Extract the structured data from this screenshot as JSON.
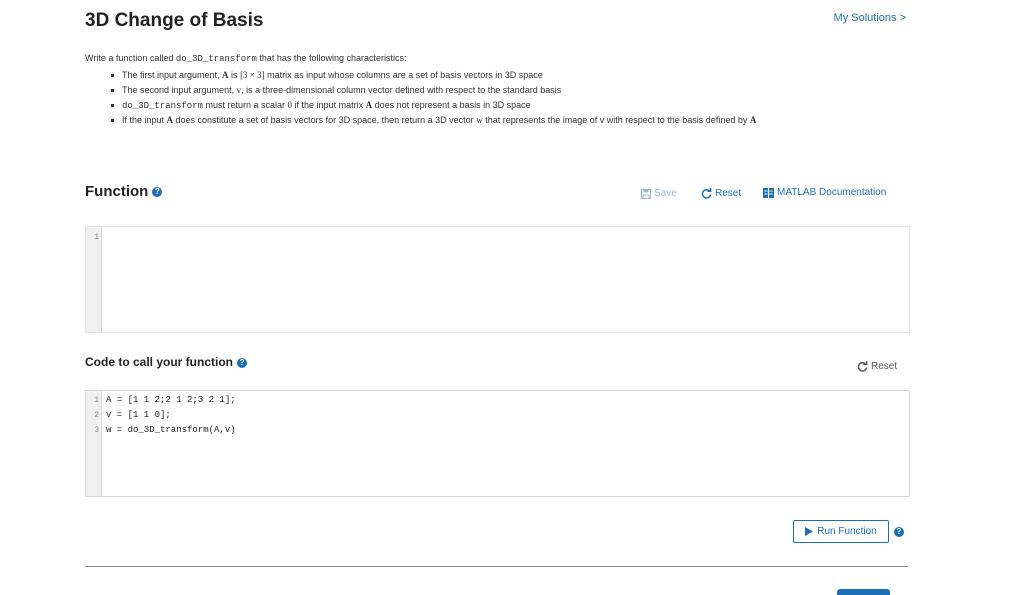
{
  "header": {
    "title": "3D Change of Basis",
    "my_solutions": "My Solutions >"
  },
  "description": {
    "intro_prefix": "Write a function called ",
    "function_name": "do_3D_transform",
    "intro_suffix": " that has the following characteristics:",
    "items": [
      {
        "p1": "The first input argument, ",
        "m1": "A",
        "p2": " is ",
        "m2": "[3 × 3]",
        "p3": " matrix as input whose columns are a set of basis vectors in 3D space"
      },
      {
        "p1": "The second input argument,  ",
        "m1": "v",
        "p2": ", is a three-dimensional column vector defined with respect to the standard basis"
      },
      {
        "m0": "do_3D_transform",
        "p1": " must return a scalar ",
        "m1": "0",
        "p2": " if the input matrix ",
        "m2": "A",
        "p3": " does not represent a basis in 3D space"
      },
      {
        "p1": "If the input ",
        "m1": "A",
        "p2": " does constitute a set of basis vectors for 3D space, then return a 3D vector ",
        "m2": "w",
        "p3": " that represents the image of v with respect to the basis defined by ",
        "m3": "A"
      }
    ]
  },
  "function_section": {
    "title": "Function",
    "save_label": "Save",
    "reset_label": "Reset",
    "docs_label": "MATLAB Documentation",
    "line_numbers": [
      "1"
    ]
  },
  "call_section": {
    "title": "Code to call your function",
    "reset_label": "Reset",
    "lines": [
      {
        "num": "1",
        "code": "A = [1 1 2;2 1 2;3 2 1];"
      },
      {
        "num": "2",
        "code": "v = [1 1 0];"
      },
      {
        "num": "3",
        "code": "w = do_3D_transform(A,v)"
      }
    ]
  },
  "run_button": {
    "label": "Run Function"
  },
  "icons": {
    "help": "?",
    "save": "floppy-icon",
    "reset": "refresh-icon",
    "docs": "documentation-icon",
    "play": "play-icon"
  },
  "colors": {
    "accent": "#1a6fb5",
    "disabled": "#9ab8d6"
  }
}
